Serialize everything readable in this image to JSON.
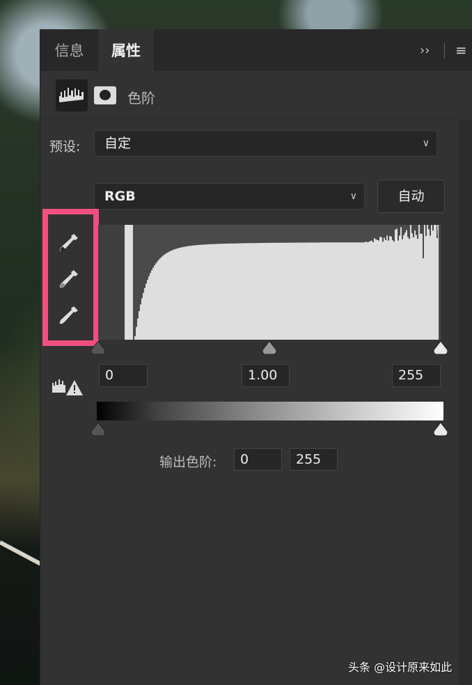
{
  "panel": {
    "tabs": [
      {
        "label": "信息",
        "active": false
      },
      {
        "label": "属性",
        "active": true
      }
    ],
    "header_icons": [
      "collapse-icon",
      "menu-icon"
    ],
    "adjustment": {
      "icon": "levels-histogram-icon",
      "mask_icon": "layer-mask-icon",
      "label": "色阶"
    },
    "preset": {
      "label": "预设:",
      "value": "自定"
    },
    "channel": {
      "value": "RGB"
    },
    "auto_button": "自动",
    "eyedroppers": [
      "black-point-eyedropper-icon",
      "gray-point-eyedropper-icon",
      "white-point-eyedropper-icon"
    ],
    "highlight_color": "#f0507f",
    "input_levels": {
      "shadow": "0",
      "midtone": "1.00",
      "highlight": "255"
    },
    "clipping_warning_icon": "clipping-warning-icon",
    "output_levels": {
      "label": "输出色阶:",
      "min": "0",
      "max": "255"
    }
  },
  "watermark": "头条 @设计原来如此"
}
